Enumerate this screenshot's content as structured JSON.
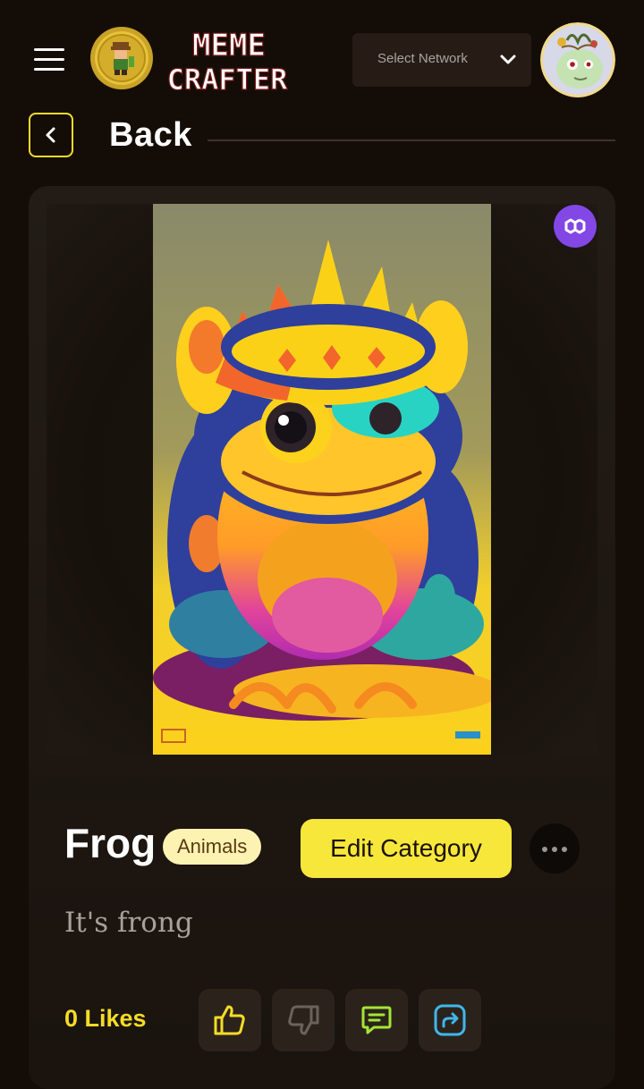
{
  "header": {
    "logo_text": [
      "MEME",
      "CRAFTER"
    ],
    "network_select": {
      "label": "Select Network"
    }
  },
  "back": {
    "label": "Back"
  },
  "meme": {
    "title": "Frog",
    "category": "Animals",
    "edit_category_label": "Edit Category",
    "description": "It's frong",
    "likes_text": "0 Likes"
  },
  "colors": {
    "background": "#140d07",
    "accent_yellow": "#f7e73b",
    "chain_badge": "#8247e5",
    "card": "#231c16"
  },
  "icons": {
    "menu": "hamburger-icon",
    "network_dropdown": "chevron-down-icon",
    "back": "chevron-left-icon",
    "chain": "polygon-icon",
    "more": "more-horizontal-icon",
    "like": "thumbs-up-icon",
    "dislike": "thumbs-down-icon",
    "comment": "comment-icon",
    "share": "share-icon"
  }
}
